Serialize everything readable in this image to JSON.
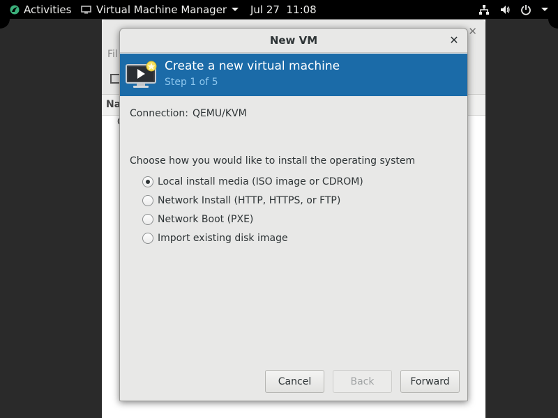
{
  "topbar": {
    "activities": "Activities",
    "app_name": "Virtual Machine Manager",
    "clock": "Jul 27  11:08",
    "tray_icons": [
      "network-icon",
      "volume-icon",
      "power-icon"
    ]
  },
  "background_window": {
    "menu_partial": "Fil",
    "column_partial": "Na",
    "row_partial": "Q"
  },
  "dialog": {
    "title": "New VM",
    "banner": {
      "heading": "Create a new virtual machine",
      "step": "Step 1 of 5",
      "color": "#1b6ba8"
    },
    "connection": {
      "label": "Connection:",
      "value": "QEMU/KVM"
    },
    "install_prompt": "Choose how you would like to install the operating system",
    "install_options": [
      {
        "label": "Local install media (ISO image or CDROM)",
        "selected": true
      },
      {
        "label": "Network Install (HTTP, HTTPS, or FTP)",
        "selected": false
      },
      {
        "label": "Network Boot (PXE)",
        "selected": false
      },
      {
        "label": "Import existing disk image",
        "selected": false
      }
    ],
    "buttons": {
      "cancel": "Cancel",
      "back": "Back",
      "forward": "Forward"
    }
  }
}
